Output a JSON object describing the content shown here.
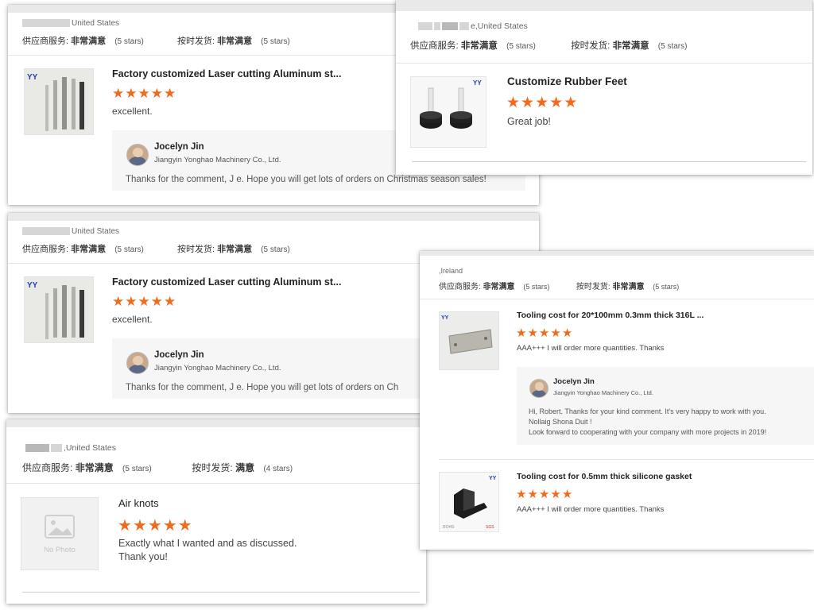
{
  "colors": {
    "star": "#f26b1d",
    "reply_bg": "#f6f6f7",
    "logo": "#1e3fb0"
  },
  "icons": {
    "star": "star-icon",
    "avatar": "avatar",
    "no_photo": "image-placeholder-icon"
  },
  "review_a": {
    "location": "United States",
    "ratings": {
      "service_label": "供应商服务:",
      "service_value": "非常满意",
      "service_stars": "(5 stars)",
      "ship_label": "按时发货:",
      "ship_value": "非常满意",
      "ship_stars": "(5 stars)"
    },
    "product_title": "Factory customized Laser cutting Aluminum st...",
    "rating_stars": 5,
    "comment": "excellent.",
    "reply": {
      "name": "Jocelyn Jin",
      "company": "Jiangyin Yonghao Machinery Co., Ltd.",
      "text": "Thanks for the comment, J    e. Hope you will get lots of orders on Christmas season sales!"
    }
  },
  "review_b": {
    "location": "e,United States",
    "ratings": {
      "service_label": "供应商服务:",
      "service_value": "非常满意",
      "service_stars": "(5 stars)",
      "ship_label": "按时发货:",
      "ship_value": "非常满意",
      "ship_stars": "(5 stars)"
    },
    "product_title": "Customize Rubber Feet",
    "rating_stars": 5,
    "comment": "Great job!"
  },
  "review_c": {
    "location": "United States",
    "ratings": {
      "service_label": "供应商服务:",
      "service_value": "非常满意",
      "service_stars": "(5 stars)",
      "ship_label": "按时发货:",
      "ship_value": "非常满意",
      "ship_stars": "(5 stars)"
    },
    "product_title": "Factory customized Laser cutting Aluminum st...",
    "rating_stars": 5,
    "comment": "excellent.",
    "reply": {
      "name": "Jocelyn Jin",
      "company": "Jiangyin Yonghao Machinery Co., Ltd.",
      "text": "Thanks for the comment, J    e. Hope you will get lots of orders on Ch"
    }
  },
  "review_d": {
    "location": ",Ireland",
    "ratings": {
      "service_label": "供应商服务:",
      "service_value": "非常满意",
      "service_stars": "(5 stars)",
      "ship_label": "按时发货:",
      "ship_value": "非常满意",
      "ship_stars": "(5 stars)"
    },
    "items": [
      {
        "product_title": "Tooling cost for 20*100mm 0.3mm thick 316L ...",
        "rating_stars": 5,
        "comment": "AAA+++ I will order more quantities. Thanks",
        "reply": {
          "name": "Jocelyn Jin",
          "company": "Jiangyin Yonghao Machinery Co., Ltd.",
          "line1": "Hi, Robert. Thanks for your kind comment. It's very happy to work with you.",
          "line2": "Nollaig Shona Duit !",
          "line3": "Look forward to cooperating with your company with more projects in 2019!"
        }
      },
      {
        "product_title": "Tooling cost for 0.5mm thick silicone gasket",
        "rating_stars": 5,
        "comment": "AAA+++ I will order more quantities. Thanks"
      }
    ]
  },
  "review_e": {
    "location": ",United States",
    "ratings": {
      "service_label": "供应商服务:",
      "service_value": "非常满意",
      "service_stars": "(5 stars)",
      "ship_label": "按时发货:",
      "ship_value": "满意",
      "ship_stars": "(4 stars)"
    },
    "product_title": "Air knots",
    "rating_stars": 5,
    "no_photo_label": "No Photo",
    "comment_line1": "Exactly what I wanted and as discussed.",
    "comment_line2": "Thank you!"
  }
}
